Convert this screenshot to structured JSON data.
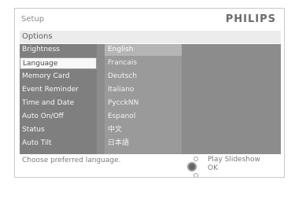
{
  "header": {
    "title": "Setup",
    "brand": "PHILIPS"
  },
  "subbar": {
    "label": "Options"
  },
  "menu": {
    "items": [
      {
        "label": "Brightness",
        "selected": false
      },
      {
        "label": "Language",
        "selected": true
      },
      {
        "label": "Memory Card",
        "selected": false
      },
      {
        "label": "Event Reminder",
        "selected": false
      },
      {
        "label": "Time and Date",
        "selected": false
      },
      {
        "label": "Auto On/Off",
        "selected": false
      },
      {
        "label": "Status",
        "selected": false
      },
      {
        "label": "Auto Tilt",
        "selected": false
      }
    ]
  },
  "languages": {
    "items": [
      {
        "label": "English",
        "selected": true
      },
      {
        "label": "Francais",
        "selected": false
      },
      {
        "label": "Deutsch",
        "selected": false
      },
      {
        "label": "Italiano",
        "selected": false
      },
      {
        "label": "PycckNN",
        "selected": false
      },
      {
        "label": "Espanol",
        "selected": false
      },
      {
        "label": "中文",
        "selected": false
      },
      {
        "label": "日本語",
        "selected": false
      }
    ]
  },
  "footer": {
    "hint": "Choose preferred language.",
    "options": {
      "play": "Play Slideshow",
      "ok": "OK"
    }
  }
}
